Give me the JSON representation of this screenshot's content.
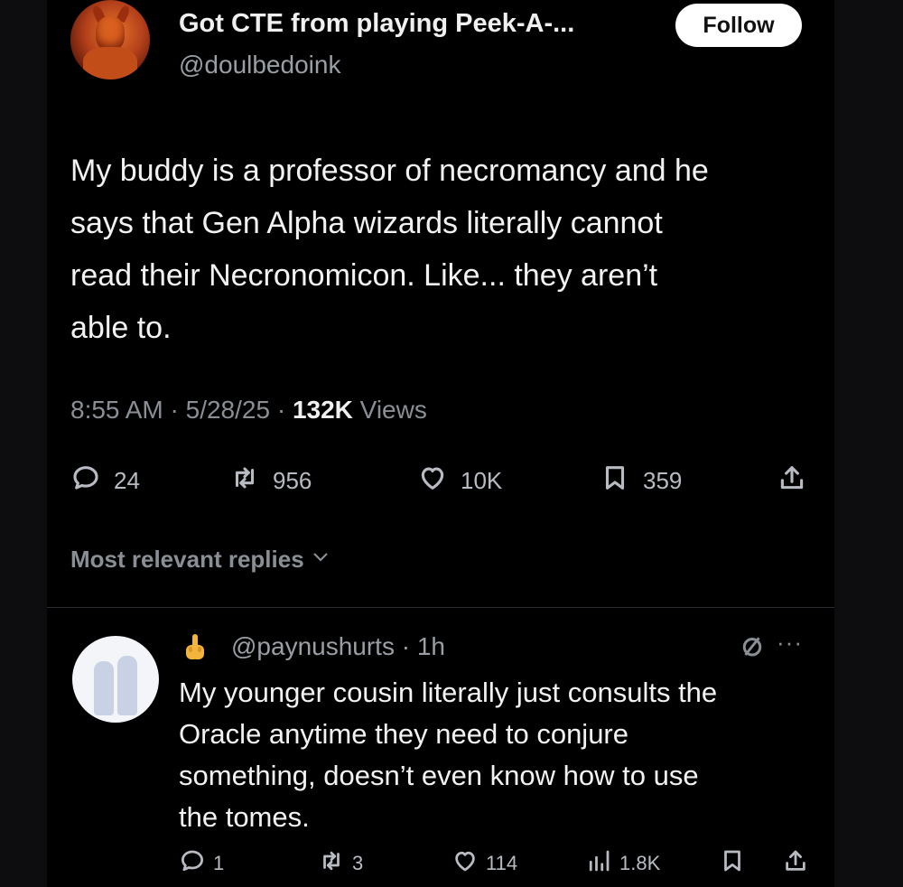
{
  "post": {
    "display_name": "Got CTE from playing Peek-A-...",
    "handle": "@doulbedoink",
    "follow_label": "Follow",
    "text_lines": [
      "My buddy is a professor of necromancy and he",
      "says that Gen Alpha wizards literally cannot",
      "read their Necronomicon. Like... they aren’t",
      "able to."
    ],
    "time": "8:55 AM",
    "date": "5/28/25",
    "views_count": "132K",
    "views_label": "Views",
    "separator": "·",
    "actions": {
      "replies": "24",
      "reposts": "956",
      "likes": "10K",
      "bookmarks": "359"
    }
  },
  "replies_sort_label": "Most relevant replies",
  "reply": {
    "handle": "@paynushurts",
    "age": "1h",
    "more_label": "···",
    "text_lines": [
      "My younger cousin literally just consults the",
      "Oracle anytime they need to conjure",
      "something, doesn’t even know how to use",
      "the tomes."
    ],
    "actions": {
      "replies": "1",
      "reposts": "3",
      "likes": "114",
      "views": "1.8K"
    }
  },
  "icons": {
    "reply": "speech-bubble-icon",
    "repost": "repost-arrows-icon",
    "like": "heart-icon",
    "bookmark": "bookmark-icon",
    "share": "share-upload-icon",
    "views": "bar-chart-icon",
    "mute": "slashed-circle-icon",
    "finger": "middle-finger-emoji-icon"
  },
  "colors": {
    "background": "#000000",
    "text": "#f2f2f2",
    "muted": "#8a8f95",
    "follow_bg": "#ffffff"
  }
}
